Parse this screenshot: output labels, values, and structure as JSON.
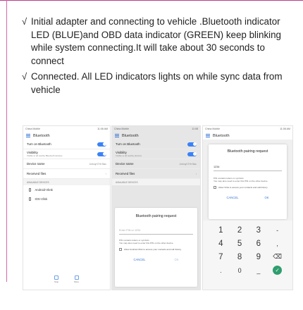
{
  "steps": [
    {
      "check": "√",
      "text": "Initial adapter and connecting to vehicle .Bluetooth indicator LED (BLUE)and OBD data indicator (GREEN) keep blinking while system connecting.It will take about 30 seconds to connect"
    },
    {
      "check": "√",
      "text": "Connected. All LED indicators lights on while sync data from vehicle"
    }
  ],
  "phones": {
    "p1": {
      "statusbar_left": "China Mobile",
      "statusbar_right": "11:08 AM",
      "title": "Bluetooth",
      "rows": [
        {
          "label": "Turn on Bluetooth",
          "sub": ""
        },
        {
          "label": "Visibility",
          "sub": "Visible to all nearby Bluetooth devices"
        },
        {
          "label": "Device name",
          "value": "Linkoyl EYe Bac"
        },
        {
          "label": "Received files",
          "value": ""
        }
      ],
      "section": "AVAILABLE DEVICES",
      "devices": [
        "Android-Vbnk",
        "IOS-Vlink"
      ],
      "actions": [
        "Stop",
        "More"
      ]
    },
    "p2": {
      "statusbar_left": "China Mobile",
      "statusbar_right": "11:08",
      "title": "Bluetooth",
      "rows": [
        {
          "label": "Turn on Bluetooth",
          "sub": ""
        },
        {
          "label": "Visibility",
          "sub": "Visible to all nearby devices"
        },
        {
          "label": "Device name",
          "value": "Linkoyl EYe Bac"
        },
        {
          "label": "Received files",
          "value": ""
        }
      ],
      "section": "AVAILABLE DEVICES",
      "dialog": {
        "title": "Bluetooth pairing request",
        "placeholder": "Enter PIN or 1234",
        "note": "PIN contains letters or symbols\nYou may also need to enter this PIN on the other device.",
        "checkbox": "Allow Android-Vlink to access your contacts and call history",
        "cancel": "CANCEL",
        "ok": "OK"
      }
    },
    "p3": {
      "statusbar_left": "China Mobile",
      "statusbar_right": "11:08 AM",
      "title": "Bluetooth",
      "dialog": {
        "title": "Bluetooth pairing request",
        "value": "1234",
        "note": "PIN contains letters or symbols\nYou may also need to enter this PIN on the other device.",
        "checkbox": "Allow Vlink to access your contacts and call history",
        "cancel": "CANCEL",
        "ok": "OK"
      },
      "keys": [
        "1",
        "2",
        "3",
        "-",
        "4",
        "5",
        "6",
        ",",
        "7",
        "8",
        "9",
        "⌫",
        ".",
        "0",
        "_",
        "✓"
      ]
    }
  },
  "colors": {
    "accent": "#3b82f6",
    "frame": "#c0398a",
    "go": "#2f9e6e"
  }
}
